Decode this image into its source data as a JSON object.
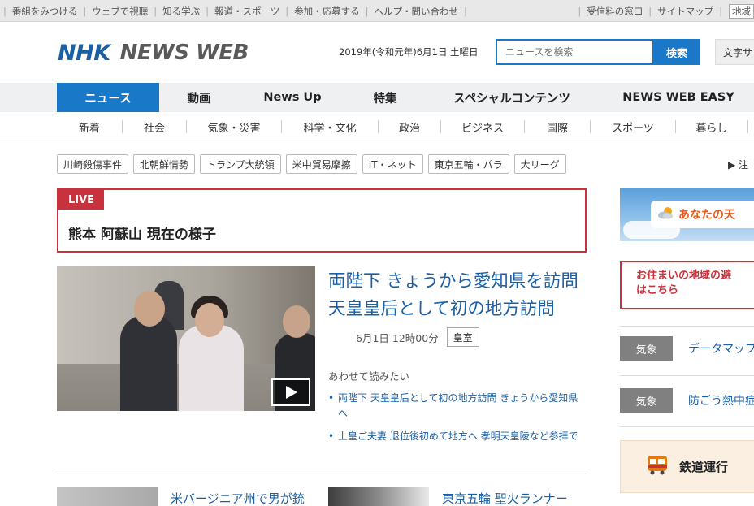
{
  "topbar": {
    "left_links": [
      "番組をみつける",
      "ウェブで視聴",
      "知る学ぶ",
      "報道・スポーツ",
      "参加・応募する",
      "ヘルプ・問い合わせ"
    ],
    "right_links": [
      "受信料の窓口",
      "サイトマップ"
    ],
    "region_button": "地域"
  },
  "header": {
    "logo_nhk": "NHK",
    "logo_newsweb": "NEWS WEB",
    "date": "2019年(令和元年)6月1日 土曜日",
    "search_placeholder": "ニュースを検索",
    "search_button": "検索",
    "text_size": "文字サ"
  },
  "main_nav": [
    {
      "label": "ニュース",
      "active": true
    },
    {
      "label": "動画",
      "active": false
    },
    {
      "label": "News Up",
      "active": false
    },
    {
      "label": "特集",
      "active": false
    },
    {
      "label": "スペシャルコンテンツ",
      "active": false
    },
    {
      "label": "NEWS WEB EASY",
      "active": false
    }
  ],
  "sub_nav": [
    "新着",
    "社会",
    "気象・災害",
    "科学・文化",
    "政治",
    "ビジネス",
    "国際",
    "スポーツ",
    "暮らし"
  ],
  "tags": [
    "川崎殺傷事件",
    "北朝鮮情勢",
    "トランプ大統領",
    "米中貿易摩擦",
    "IT・ネット",
    "東京五輪・パラ",
    "大リーグ"
  ],
  "more_tag": "▶ 注",
  "live": {
    "label": "LIVE",
    "title": "熊本 阿蘇山 現在の様子"
  },
  "top_story": {
    "headline": "両陛下 きょうから愛知県を訪問 天皇皇后として初の地方訪問",
    "time": "6月1日 12時00分",
    "genre": "皇室",
    "related_heading": "あわせて読みたい",
    "related": [
      "両陛下 天皇皇后として初の地方訪問 きょうから愛知県へ",
      "上皇ご夫妻 退位後初めて地方へ 孝明天皇陵など参拝で"
    ]
  },
  "secondary": [
    {
      "title": "米バージニア州で男が銃"
    },
    {
      "title": "東京五輪 聖火ランナー"
    }
  ],
  "sidebar": {
    "weather_label": "あなたの天",
    "evac_text": "お住まいの地域の避\nはこちら",
    "rows": [
      {
        "badge": "気象",
        "text": "データマップ"
      },
      {
        "badge": "気象",
        "text": "防ごう熱中症"
      }
    ],
    "rail_text": "鉄道運行"
  },
  "colors": {
    "accent_blue": "#1a78c8",
    "link_blue": "#1b5fa4",
    "live_red": "#c8323c",
    "weather_orange": "#e85a1e"
  }
}
